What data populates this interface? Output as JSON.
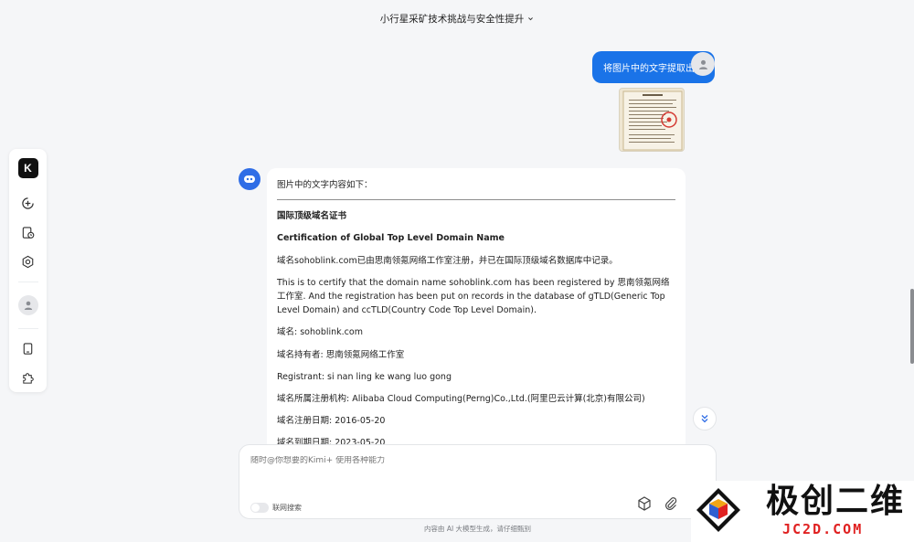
{
  "header": {
    "title": "小行星采矿技术挑战与安全性提升"
  },
  "user_message": {
    "text": "将图片中的文字提取出来"
  },
  "answer": {
    "intro": "图片中的文字内容如下：",
    "heading_cn": "国际顶级域名证书",
    "heading_en": "Certification of Global Top Level Domain Name",
    "p1": "域名sohoblink.com已由思南领氪网络工作室注册，并已在国际顶级域名数据库中记录。",
    "p2": "This is to certify that the domain name sohoblink.com has been registered by 思南领氪网络工作室. And the registration has been put on records in the database of gTLD(Generic Top Level Domain) and ccTLD(Country Code Top Level Domain).",
    "domain": "域名: sohoblink.com",
    "holder": "域名持有者: 思南领氪网络工作室",
    "registrant": "Registrant: si nan ling ke wang luo gong",
    "registrar": "域名所属注册机构: Alibaba Cloud Computing(Perng)Co.,Ltd.(阿里巴云计算(北京)有限公司)",
    "reg_date": "域名注册日期: 2016-05-20",
    "exp_date": "域名到期日期: 2023-05-20"
  },
  "composer": {
    "placeholder": "随时@你想要的Kimi+ 使用各种能力",
    "web_search_label": "联网搜索"
  },
  "footer_note": "内容由 AI 大模型生成，请仔细甄别",
  "watermark": {
    "title": "极创二维",
    "url": "JC2D.COM"
  },
  "colors": {
    "accent": "#1a73e8",
    "bot_avatar": "#2f6de6",
    "watermark_red": "#e02121"
  },
  "icons": [
    "chevron-down-icon",
    "kimi-logo-icon",
    "new-chat-icon",
    "history-icon",
    "kimi-plus-icon",
    "user-icon",
    "tablet-icon",
    "plugin-icon",
    "bot-icon",
    "double-chevron-down-icon",
    "cube-icon",
    "paperclip-icon"
  ]
}
